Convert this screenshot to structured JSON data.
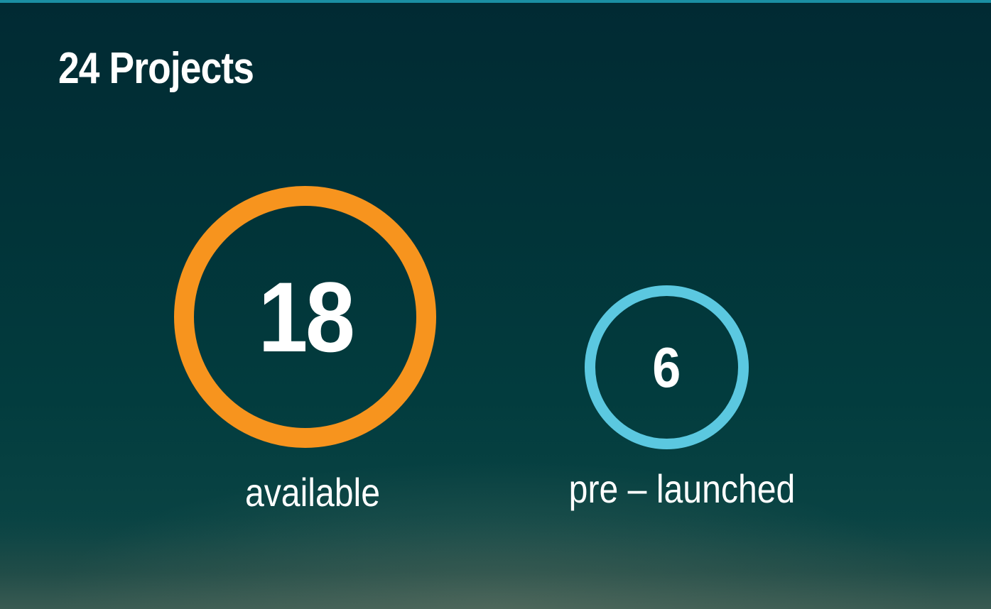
{
  "header": {
    "title": "24 Projects"
  },
  "stats": {
    "available": {
      "value": "18",
      "label": "available",
      "ring_color": "#f7941e"
    },
    "prelaunched": {
      "value": "6",
      "label": "pre – launched",
      "ring_color": "#5bc8e0"
    }
  },
  "theme": {
    "accent_bar": "#1a8fa3",
    "background": "#013338",
    "text": "#ffffff"
  }
}
